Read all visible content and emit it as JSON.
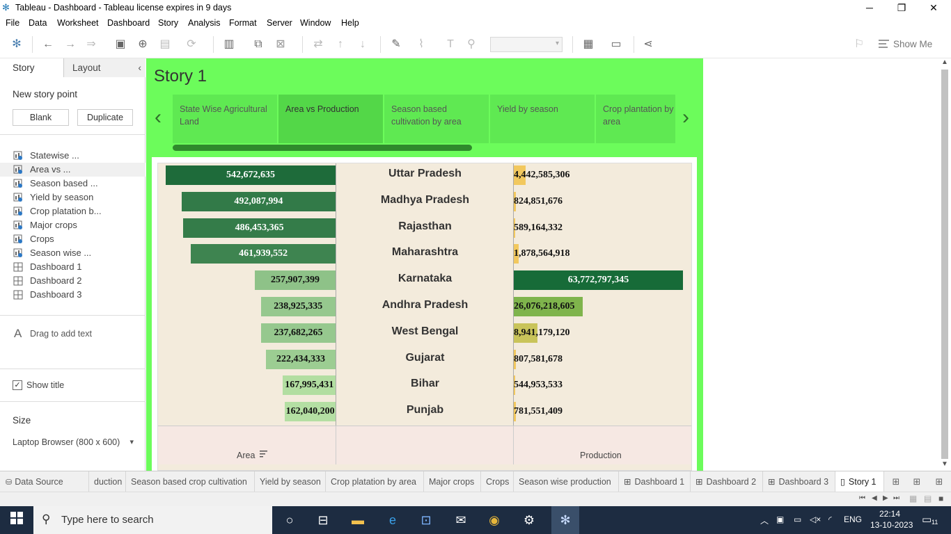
{
  "window": {
    "title": "Tableau - Dashboard - Tableau license expires in 9 days",
    "min": "─",
    "restore": "❐",
    "close": "✕"
  },
  "menu": [
    "File",
    "Data",
    "Worksheet",
    "Dashboard",
    "Story",
    "Analysis",
    "Format",
    "Server",
    "Window",
    "Help"
  ],
  "toolbar": {
    "show_me": "Show Me"
  },
  "left_pane": {
    "tabs": {
      "story": "Story",
      "layout": "Layout"
    },
    "new_story_point": "New story point",
    "blank_button": "Blank",
    "duplicate_button": "Duplicate",
    "sheets": [
      {
        "label": "Statewise ...",
        "type": "sheet"
      },
      {
        "label": "Area vs ...",
        "type": "sheet"
      },
      {
        "label": "Season based ...",
        "type": "sheet"
      },
      {
        "label": "Yield by season",
        "type": "sheet"
      },
      {
        "label": "Crop platation b...",
        "type": "sheet"
      },
      {
        "label": "Major crops",
        "type": "sheet"
      },
      {
        "label": "Crops",
        "type": "sheet"
      },
      {
        "label": "Season wise ...",
        "type": "sheet"
      },
      {
        "label": "Dashboard 1",
        "type": "dashboard"
      },
      {
        "label": "Dashboard 2",
        "type": "dashboard"
      },
      {
        "label": "Dashboard 3",
        "type": "dashboard"
      }
    ],
    "drag_text": "Drag to add text",
    "text_icon": "A",
    "show_title": "Show title",
    "check_mark": "✓",
    "size_label": "Size",
    "size_value": "Laptop Browser (800 x 600)"
  },
  "story": {
    "title": "Story 1",
    "prev_arrow": "‹",
    "next_arrow": "›",
    "points": [
      {
        "label": "State Wise Agricultural Land"
      },
      {
        "label": "Area vs Production"
      },
      {
        "label": "Season based cultivation by area"
      },
      {
        "label": "Yield by season"
      },
      {
        "label": "Crop plantation by area"
      }
    ],
    "active_point": 1
  },
  "chart_data": {
    "type": "bar",
    "title": "",
    "categories": [
      "Uttar Pradesh",
      "Madhya Pradesh",
      "Rajasthan",
      "Maharashtra",
      "Karnataka",
      "Andhra Pradesh",
      "West Bengal",
      "Gujarat",
      "Bihar",
      "Punjab"
    ],
    "series": [
      {
        "name": "Area",
        "values": [
          542672635,
          492087994,
          486453365,
          461939552,
          257907399,
          238925335,
          237682265,
          222434333,
          167995431,
          162040200
        ]
      },
      {
        "name": "Production",
        "values": [
          4442585306,
          824851676,
          589164332,
          1878564918,
          63772797345,
          26076218605,
          8941179120,
          807581678,
          544953533,
          781551409
        ]
      }
    ],
    "labels": {
      "Area": [
        "542,672,635",
        "492,087,994",
        "486,453,365",
        "461,939,552",
        "257,907,399",
        "238,925,335",
        "237,682,265",
        "222,434,333",
        "167,995,431",
        "162,040,200"
      ],
      "Production": [
        "4,442,585,306",
        "824,851,676",
        "589,164,332",
        "1,878,564,918",
        "63,772,797,345",
        "26,076,218,605",
        "8,941,179,120",
        "807,581,678",
        "544,953,533",
        "781,551,409"
      ]
    },
    "xlabel_left": "Area",
    "xlabel_right": "Production",
    "sort_icon": "sort-descending-icon",
    "colors": {
      "area_high": "#1e6b3a",
      "area_low": "#b9e3a6",
      "prod_high": "#176b38",
      "prod_mid": "#7fb44c",
      "prod_low": "#f2c85e"
    }
  },
  "bottom_tabs": [
    {
      "label": "Data Source",
      "active": false
    },
    {
      "label": "duction",
      "active": false
    },
    {
      "label": "Season based crop cultivation",
      "active": false
    },
    {
      "label": "Yield by season",
      "active": false
    },
    {
      "label": "Crop platation by area",
      "active": false
    },
    {
      "label": "Major crops",
      "active": false
    },
    {
      "label": "Crops",
      "active": false
    },
    {
      "label": "Season wise production",
      "active": false
    },
    {
      "label": "Dashboard 1",
      "active": false
    },
    {
      "label": "Dashboard 2",
      "active": false
    },
    {
      "label": "Dashboard 3",
      "active": false
    },
    {
      "label": "Story 1",
      "active": true
    }
  ],
  "taskbar": {
    "search_placeholder": "Type here to search",
    "time": "22:14",
    "date": "13-10-2023",
    "lang": "ENG",
    "notification_count": "11"
  }
}
